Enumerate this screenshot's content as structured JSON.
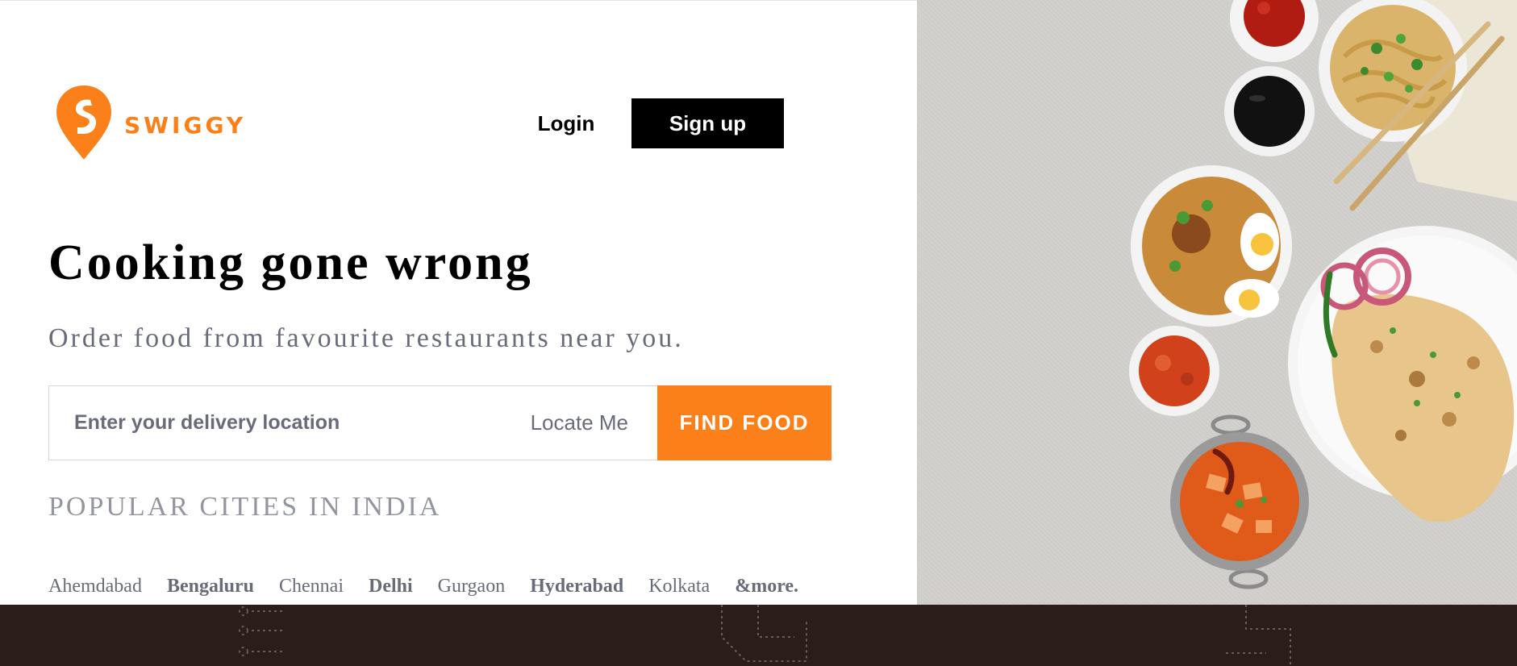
{
  "brand": {
    "name": "SWIGGY",
    "accent": "#fc8019",
    "logo_icon": "swiggy-pin-icon"
  },
  "header": {
    "login_label": "Login",
    "signup_label": "Sign up"
  },
  "hero": {
    "title": "Cooking gone wrong",
    "subtitle": "Order food from favourite restaurants near you."
  },
  "search": {
    "placeholder": "Enter your delivery location",
    "value": "",
    "locate_label": "Locate Me",
    "find_label": "FIND FOOD"
  },
  "popular_cities": {
    "title": "POPULAR CITIES IN INDIA",
    "items": [
      {
        "label": "Ahemdabad",
        "bold": false
      },
      {
        "label": "Bengaluru",
        "bold": true
      },
      {
        "label": "Chennai",
        "bold": false
      },
      {
        "label": "Delhi",
        "bold": true
      },
      {
        "label": "Gurgaon",
        "bold": false
      },
      {
        "label": "Hyderabad",
        "bold": true
      },
      {
        "label": "Kolkata",
        "bold": false
      },
      {
        "label": "&more.",
        "bold": true
      }
    ]
  },
  "colors": {
    "text_dark": "#000000",
    "text_muted": "#686b78",
    "text_light": "#93959f",
    "footer_bg": "#2b1e1a",
    "photo_bg": "#d1cfcc"
  }
}
